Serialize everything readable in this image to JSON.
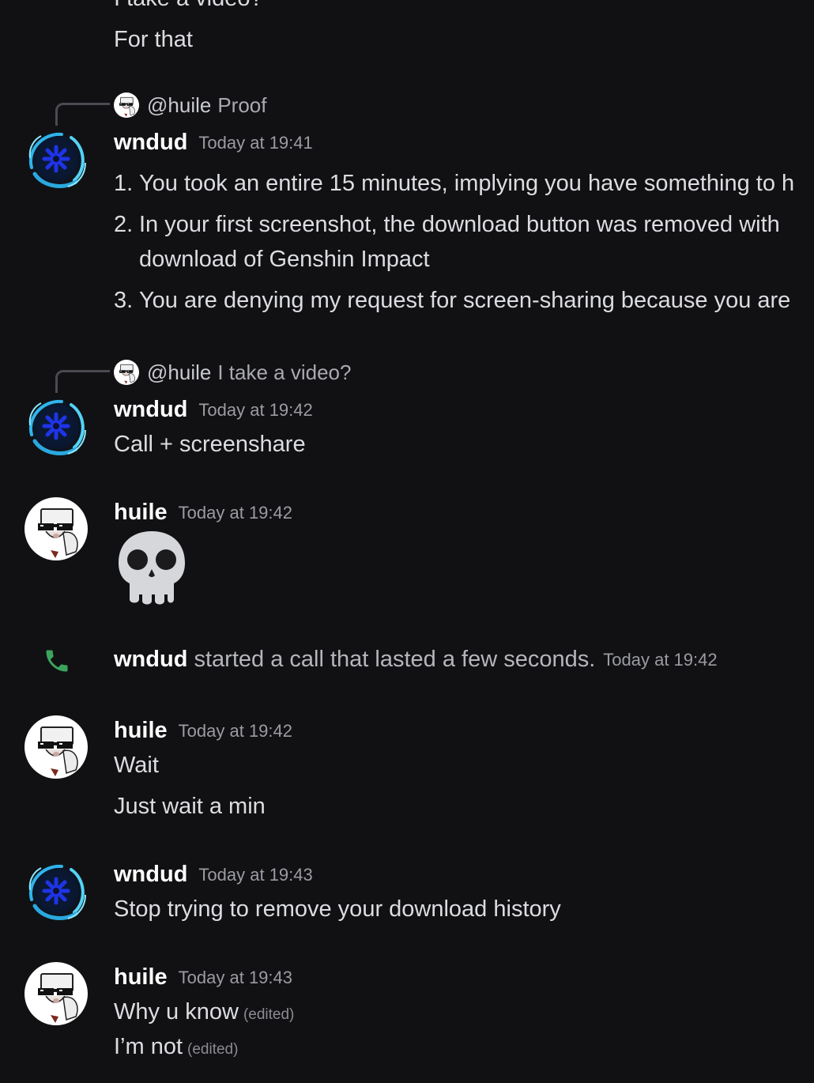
{
  "top": {
    "partial_line": "I take a video?",
    "line": "For that"
  },
  "m1": {
    "reply_mention": "@huile",
    "reply_text": "Proof",
    "author": "wndud",
    "time": "Today at 19:41",
    "items": [
      {
        "num": "1.",
        "text": "You took an entire 15 minutes, implying you have something to h"
      },
      {
        "num": "2.",
        "text": "In your first screenshot, the download button was removed with",
        "cont": "download of Genshin Impact"
      },
      {
        "num": "3.",
        "text": "You are denying my request for screen-sharing because you are"
      }
    ]
  },
  "m2": {
    "reply_mention": "@huile",
    "reply_text": "I take a video?",
    "author": "wndud",
    "time": "Today at 19:42",
    "text": "Call + screenshare"
  },
  "m3": {
    "author": "huile",
    "time": "Today at 19:42",
    "emoji": "skull"
  },
  "call": {
    "author": "wndud",
    "text": "started a call that lasted a few seconds.",
    "time": "Today at 19:42"
  },
  "m4": {
    "author": "huile",
    "time": "Today at 19:42",
    "lines": [
      "Wait",
      "Just wait a min"
    ]
  },
  "m5": {
    "author": "wndud",
    "time": "Today at 19:43",
    "text": "Stop trying to remove your download history"
  },
  "m6": {
    "author": "huile",
    "time": "Today at 19:43",
    "lines": [
      "Why u know",
      "I’m not"
    ],
    "edited": "(edited)"
  },
  "colors": {
    "background": "#111113",
    "text": "#dcdde1",
    "username": "#ffffff",
    "timestamp": "#9b9ca3",
    "call_icon": "#3ba55d",
    "wndud_ring": "#3fc8f0",
    "wndud_core": "#1a2fd8"
  }
}
